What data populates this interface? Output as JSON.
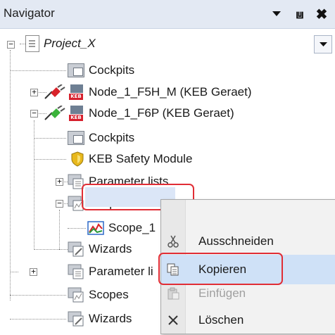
{
  "panel": {
    "title": "Navigator",
    "pin_symbol": "⩏",
    "close_symbol": "✖"
  },
  "tree": [
    {
      "label": "Project_X",
      "icon": "project-document-icon"
    },
    {
      "label": "Cockpits",
      "icon": "cockpit-window-icon"
    },
    {
      "label": "Node_1_F5H_M (KEB Geraet)",
      "icon": "keb-device-icon",
      "connection": "disconnected-red-plug-icon"
    },
    {
      "label": "Node_1_F6P (KEB Geraet)",
      "icon": "keb-device-icon",
      "connection": "connected-green-plug-icon"
    },
    {
      "label": "Cockpits",
      "icon": "cockpit-window-icon"
    },
    {
      "label": "KEB Safety Module",
      "icon": "safety-shield-icon"
    },
    {
      "label": "Parameter lists",
      "icon": "parameter-list-icon"
    },
    {
      "label": "Scopes",
      "icon": "scopes-icon"
    },
    {
      "label": "Scope_1",
      "icon": "scope-chart-icon"
    },
    {
      "label": "Wizards",
      "icon": "wizard-icon"
    },
    {
      "label": "Parameter li",
      "icon": "parameter-list-icon"
    },
    {
      "label": "Scopes",
      "icon": "scopes-icon"
    },
    {
      "label": "Wizards",
      "icon": "wizard-icon"
    }
  ],
  "context_menu": {
    "items": [
      {
        "label": "Ausschneiden",
        "icon": "cut-icon",
        "enabled": true
      },
      {
        "label": "Kopieren",
        "icon": "copy-icon",
        "enabled": true,
        "selected": true
      },
      {
        "label": "Einfügen",
        "icon": "paste-icon",
        "enabled": false
      },
      {
        "label": "Löschen",
        "icon": "delete-icon",
        "enabled": true
      }
    ]
  },
  "colors": {
    "header_bg": "#e3e9f3",
    "highlight_red": "#e12d35",
    "selection_blue": "#cfe1f7",
    "keb_red": "#d61f2c"
  }
}
